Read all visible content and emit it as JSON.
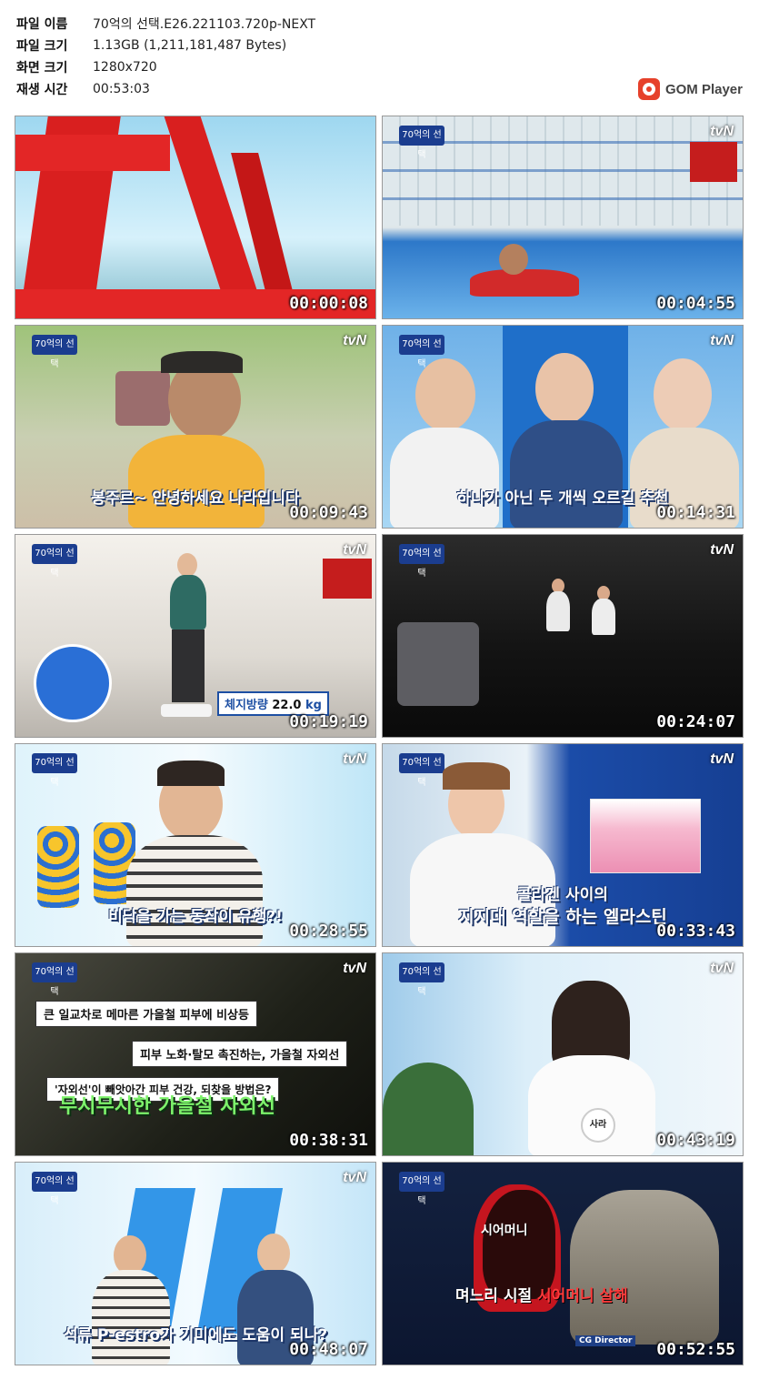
{
  "info": {
    "rows": [
      {
        "key": "파일 이름",
        "value": "70억의 선택.E26.221103.720p-NEXT"
      },
      {
        "key": "파일 크기",
        "value": "1.13GB (1,211,181,487 Bytes)"
      },
      {
        "key": "화면 크기",
        "value": "1280x720"
      },
      {
        "key": "재생 시간",
        "value": "00:53:03"
      }
    ]
  },
  "brand": {
    "name": "GOM Player",
    "color": "#e6412b"
  },
  "thumbnails": [
    {
      "time": "00:00:08",
      "caption": ""
    },
    {
      "time": "00:04:55",
      "caption": ""
    },
    {
      "time": "00:09:43",
      "caption": "봉주르~ 안녕하세요 나라입니다"
    },
    {
      "time": "00:14:31",
      "caption": "하나가 아닌 두 개씩 오르길 추천"
    },
    {
      "time": "00:19:19",
      "caption": "",
      "weight_label": "체지방량",
      "weight_value": "22.0",
      "weight_unit": "kg"
    },
    {
      "time": "00:24:07",
      "caption": ""
    },
    {
      "time": "00:28:55",
      "caption": "비닥을 가는 동작이 유행?!"
    },
    {
      "time": "00:33:43",
      "caption_line1": "콜라겐 사이의",
      "caption_line2": "지지대 역할을 하는 엘라스틴"
    },
    {
      "time": "00:38:31",
      "box1": "큰 일교차로 메마른 가을철 피부에 비상등",
      "box2": "피부 노화·탈모 촉진하는, 가을철 자외선",
      "box3": "'자외선'이 빼앗아간 피부 건강, 되찾을 방법은?",
      "caption": "무시무시한 가을철 자외선"
    },
    {
      "time": "00:43:19",
      "caption": "",
      "name_tag": "사라"
    },
    {
      "time": "00:48:07",
      "caption": "석류 P-estro가 기미에도 도움이 되나?"
    },
    {
      "time": "00:52:55",
      "label1": "시어머니",
      "caption_a": "며느리 시절",
      "caption_b": "시어머니 살해",
      "credits": [
        "CG Director"
      ]
    }
  ],
  "channel": "tvN",
  "show_badge": "70억의 선택"
}
